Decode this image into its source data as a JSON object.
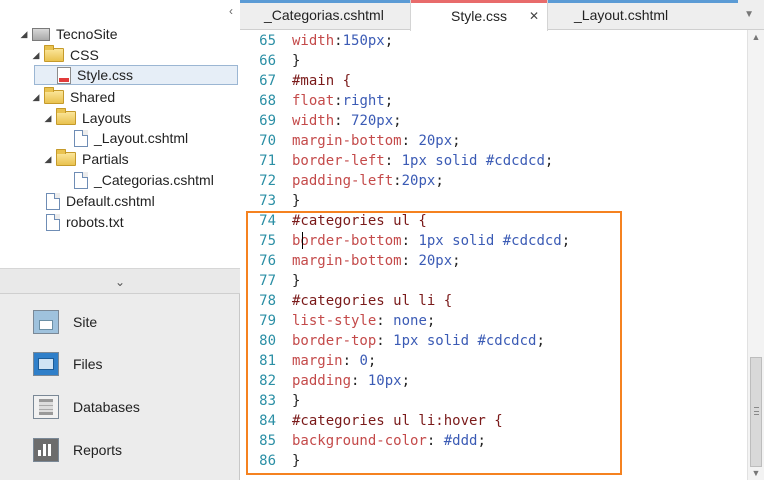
{
  "tree": {
    "root": "TecnoSite",
    "items": [
      {
        "label": "CSS"
      },
      {
        "label": "Style.css"
      },
      {
        "label": "Shared"
      },
      {
        "label": "Layouts"
      },
      {
        "label": "_Layout.cshtml"
      },
      {
        "label": "Partials"
      },
      {
        "label": "_Categorias.cshtml"
      },
      {
        "label": "Default.cshtml"
      },
      {
        "label": "robots.txt"
      }
    ]
  },
  "workspaces": [
    "Site",
    "Files",
    "Databases",
    "Reports"
  ],
  "tabs": [
    {
      "label": "_Categorias.cshtml",
      "stripe": "#5b9bd5"
    },
    {
      "label": "Style.css",
      "stripe": "#e86b6b"
    },
    {
      "label": "_Layout.cshtml",
      "stripe": "#5b9bd5"
    }
  ],
  "code": {
    "lines": [
      {
        "n": "65",
        "text": "width:150px;"
      },
      {
        "n": "66",
        "text": "}"
      },
      {
        "n": "67",
        "text": "#main {"
      },
      {
        "n": "68",
        "text": "float:right;"
      },
      {
        "n": "69",
        "text": "width: 720px;"
      },
      {
        "n": "70",
        "text": "margin-bottom: 20px;"
      },
      {
        "n": "71",
        "text": "border-left: 1px solid #cdcdcd;"
      },
      {
        "n": "72",
        "text": "padding-left:20px;"
      },
      {
        "n": "73",
        "text": "}"
      },
      {
        "n": "74",
        "text": "#categories ul {"
      },
      {
        "n": "75",
        "text": "border-bottom: 1px solid #cdcdcd;"
      },
      {
        "n": "76",
        "text": "margin-bottom: 20px;"
      },
      {
        "n": "77",
        "text": "}"
      },
      {
        "n": "78",
        "text": "#categories ul li {"
      },
      {
        "n": "79",
        "text": "list-style: none;"
      },
      {
        "n": "80",
        "text": "border-top: 1px solid #cdcdcd;"
      },
      {
        "n": "81",
        "text": "margin: 0;"
      },
      {
        "n": "82",
        "text": "padding: 10px;"
      },
      {
        "n": "83",
        "text": "}"
      },
      {
        "n": "84",
        "text": "#categories ul li:hover {"
      },
      {
        "n": "85",
        "text": "background-color: #ddd;"
      },
      {
        "n": "86",
        "text": "}"
      }
    ]
  },
  "colors": {
    "highlight": "#f58220",
    "line_number": "#2b8fa5",
    "property": "#c44a4a",
    "value": "#3b5bb5"
  }
}
